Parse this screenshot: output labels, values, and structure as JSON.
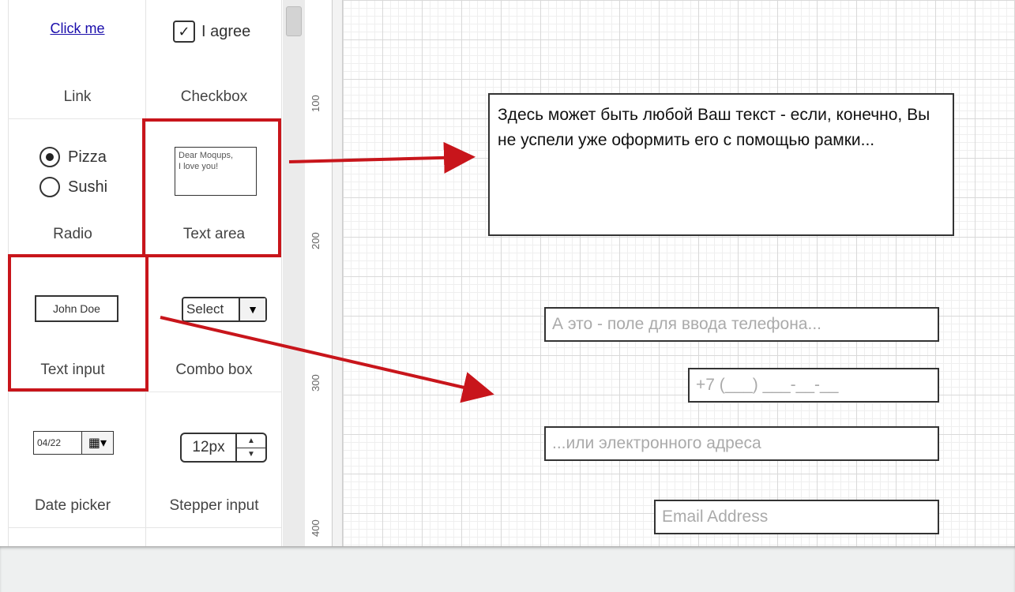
{
  "palette": {
    "link": {
      "preview_text": "Click me",
      "caption": "Link"
    },
    "checkbox": {
      "preview_text": "I agree",
      "caption": "Checkbox"
    },
    "radio": {
      "option1": "Pizza",
      "option2": "Sushi",
      "caption": "Radio"
    },
    "textarea": {
      "preview_line1": "Dear Moqups,",
      "preview_line2": "I love you!",
      "caption": "Text area"
    },
    "textinput": {
      "preview_text": "John Doe",
      "caption": "Text input"
    },
    "combobox": {
      "preview_text": "Select",
      "caption": "Combo box"
    },
    "datepicker": {
      "preview_text": "04/22",
      "caption": "Date picker"
    },
    "stepper": {
      "preview_text": "12px",
      "caption": "Stepper input"
    }
  },
  "ruler": {
    "labels": [
      "100",
      "200",
      "300",
      "400"
    ]
  },
  "canvas": {
    "textarea_text": "Здесь может быть любой Ваш текст - если, конечно, Вы не успели уже оформить его с помощью рамки...",
    "phone_hint": "А это - поле для ввода телефона...",
    "phone_mask": "+7 (___) ___-__-__",
    "email_hint": "...или электронного адреса",
    "email_placeholder": "Email Address"
  },
  "colors": {
    "highlight": "#c8151b",
    "link": "#1a0dab"
  }
}
